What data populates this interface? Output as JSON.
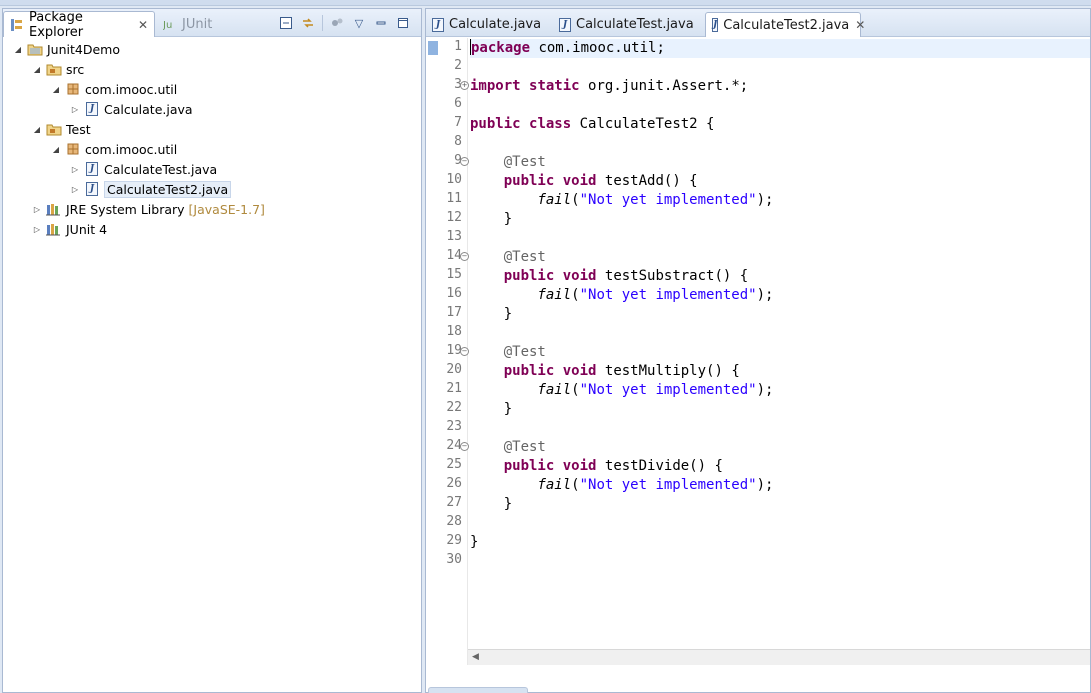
{
  "package_explorer": {
    "tabs": [
      {
        "label": "Package Explorer",
        "active": true
      },
      {
        "label": "JUnit",
        "active": false
      }
    ],
    "tree": [
      {
        "label": "Junit4Demo",
        "icon": "project-icon",
        "expanded": true
      },
      {
        "label": "src",
        "icon": "source-folder-icon",
        "expanded": true
      },
      {
        "label": "com.imooc.util",
        "icon": "package-icon",
        "expanded": true
      },
      {
        "label": "Calculate.java",
        "icon": "java-file-icon",
        "expanded": false
      },
      {
        "label": "Test",
        "icon": "source-folder-icon",
        "expanded": true
      },
      {
        "label": "com.imooc.util",
        "icon": "package-icon",
        "expanded": true
      },
      {
        "label": "CalculateTest.java",
        "icon": "java-file-icon",
        "expanded": false
      },
      {
        "label": "CalculateTest2.java",
        "icon": "java-file-icon",
        "expanded": false,
        "selected": true
      },
      {
        "label": "JRE System Library",
        "decoration": "[JavaSE-1.7]",
        "icon": "library-icon",
        "expanded": false
      },
      {
        "label": "JUnit 4",
        "icon": "library-icon",
        "expanded": false
      }
    ]
  },
  "editor": {
    "tabs": [
      {
        "label": "Calculate.java",
        "active": false
      },
      {
        "label": "CalculateTest.java",
        "active": false
      },
      {
        "label": "CalculateTest2.java",
        "active": true
      }
    ],
    "line_numbers": [
      "1",
      "2",
      "3",
      "6",
      "7",
      "8",
      "9",
      "10",
      "11",
      "12",
      "13",
      "14",
      "15",
      "16",
      "17",
      "18",
      "19",
      "20",
      "21",
      "22",
      "23",
      "24",
      "25",
      "26",
      "27",
      "28",
      "29",
      "30"
    ],
    "code": {
      "l1": "com.imooc.util;",
      "l3": "org.junit.Assert.*;",
      "l7": "CalculateTest2 {",
      "tests": [
        {
          "annotation": "@Test",
          "method": "testAdd() {",
          "call": "fail",
          "msg": "\"Not yet implemented\"",
          "end": ");"
        },
        {
          "annotation": "@Test",
          "method": "testSubstract() {",
          "call": "fail",
          "msg": "\"Not yet implemented\"",
          "end": ");"
        },
        {
          "annotation": "@Test",
          "method": "testMultiply() {",
          "call": "fail",
          "msg": "\"Not yet implemented\"",
          "end": ");"
        },
        {
          "annotation": "@Test",
          "method": "testDivide() {",
          "call": "fail",
          "msg": "\"Not yet implemented\"",
          "end": ");"
        }
      ],
      "keywords": {
        "package": "package",
        "import": "import",
        "static": "static",
        "public": "public",
        "class": "class",
        "void": "void"
      },
      "brace_close": "}",
      "brace_open_paren": "("
    }
  },
  "colors": {
    "keyword": "#7f0055",
    "string": "#2a00ff",
    "annotation": "#646464",
    "current_line": "#e8f2fe"
  }
}
